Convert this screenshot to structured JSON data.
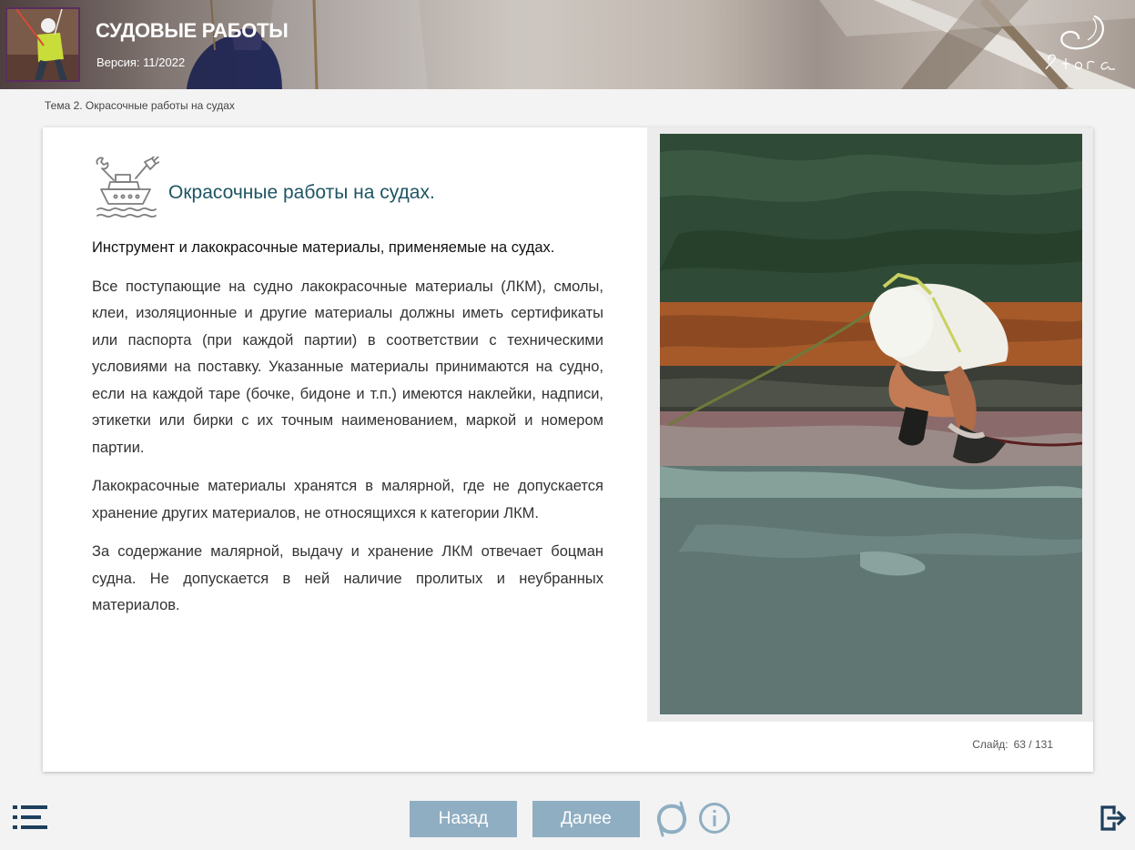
{
  "header": {
    "course_title": "СУДОВЫЕ РАБОТЫ",
    "version": "Версия: 11/2022",
    "brand_logo_icon": "stora-script-logo",
    "thumbnail": "worker-in-harness-photo"
  },
  "breadcrumb": "Тема 2. Окрасочные работы на судах",
  "slide": {
    "topic_icon": "ship-with-tools-icon",
    "heading": "Окрасочные работы на судах.",
    "lead": "Инструмент и лакокрасочные материалы, применяемые на судах.",
    "paragraphs": [
      "Все поступающие на судно лакокрасочные материалы (ЛКМ), смолы, клеи, изоляционные и другие материалы должны иметь сертификаты или паспорта (при каждой партии) в соответствии с техническими условиями на поставку. Указанные материалы принимаются на судно, если на каждой таре (бочке, бидоне и т.п.) имеются наклейки, надписи, этикетки или бирки с их точным наименованием, маркой и номером партии.",
      "Лакокрасочные материалы хранятся в малярной, где не допускается хранение других материалов, не относящихся к категории ЛКМ.",
      "За содержание малярной, выдачу и хранение ЛКМ отвечает боцман судна. Не допускается в ней наличие пролитых и неубранных материалов."
    ],
    "photo": "worker-painting-deck-photo",
    "counter_label": "Слайд:",
    "counter_value": "63 / 131"
  },
  "footer": {
    "back_label": "Назад",
    "next_label": "Далее",
    "icons": [
      "menu-icon",
      "reload-icon",
      "info-icon",
      "exit-icon"
    ]
  },
  "colors": {
    "heading": "#1e5563",
    "button": "#8faec2",
    "icon": "#1e3f5c",
    "background": "#f3f3f3"
  }
}
